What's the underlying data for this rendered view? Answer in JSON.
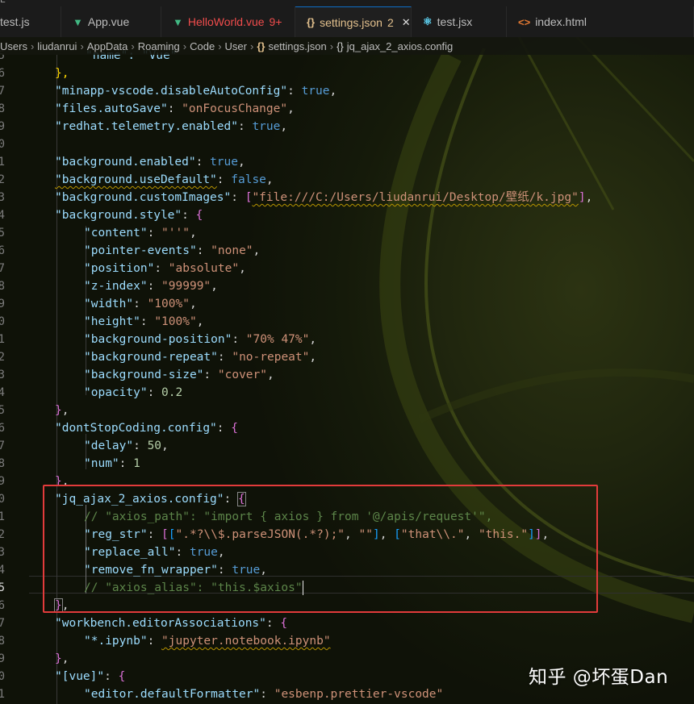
{
  "top_strip": {
    "left_text": "L",
    "right_text": "·"
  },
  "tabs": [
    {
      "label": "test.js",
      "icon": "js-file-icon",
      "color": "#cccccc"
    },
    {
      "label": "App.vue",
      "icon": "vue-icon",
      "color": "#cccccc"
    },
    {
      "label": "HelloWorld.vue",
      "badge": "9+",
      "icon": "vue-icon",
      "color": "#f14c4c"
    },
    {
      "label": "settings.json",
      "badge": "2",
      "icon": "json-braces-icon",
      "color": "#e2c08d",
      "active": true
    },
    {
      "label": "test.jsx",
      "icon": "react-icon",
      "color": "#cccccc"
    },
    {
      "label": "index.html",
      "icon": "html-icon",
      "color": "#cccccc"
    }
  ],
  "breadcrumb": [
    "Users",
    "liudanrui",
    "AppData",
    "Roaming",
    "Code",
    "User",
    "settings.json",
    "jq_ajax_2_axios.config"
  ],
  "line_numbers": [
    "5",
    "6",
    "7",
    "8",
    "9",
    "0",
    "1",
    "2",
    "3",
    "4",
    "5",
    "6",
    "7",
    "8",
    "9",
    "0",
    "1",
    "2",
    "3",
    "4",
    "5",
    "6",
    "7",
    "8",
    "9",
    "0",
    "1",
    "2",
    "3",
    "4",
    "5",
    "6",
    "7",
    "8",
    "9",
    "0",
    "1"
  ],
  "current_line_index": 30,
  "code": {
    "l0": "\"name\": \"Vue\"",
    "l1_close": "},",
    "l2_key": "\"minapp-vscode.disableAutoConfig\"",
    "l2_val": "true",
    "l3_key": "\"files.autoSave\"",
    "l3_val": "\"onFocusChange\"",
    "l4_key": "\"redhat.telemetry.enabled\"",
    "l4_val": "true",
    "l6_key": "\"background.enabled\"",
    "l6_val": "true",
    "l7_key": "\"background.useDefault\"",
    "l7_val": "false",
    "l8_key": "\"background.customImages\"",
    "l8_val": "\"file:///C:/Users/liudanrui/Desktop/壁纸/k.jpg\"",
    "l9_key": "\"background.style\"",
    "l10_key": "\"content\"",
    "l10_val": "\"''\"",
    "l11_key": "\"pointer-events\"",
    "l11_val": "\"none\"",
    "l12_key": "\"position\"",
    "l12_val": "\"absolute\"",
    "l13_key": "\"z-index\"",
    "l13_val": "\"99999\"",
    "l14_key": "\"width\"",
    "l14_val": "\"100%\"",
    "l15_key": "\"height\"",
    "l15_val": "\"100%\"",
    "l16_key": "\"background-position\"",
    "l16_val": "\"70% 47%\"",
    "l17_key": "\"background-repeat\"",
    "l17_val": "\"no-repeat\"",
    "l18_key": "\"background-size\"",
    "l18_val": "\"cover\"",
    "l19_key": "\"opacity\"",
    "l19_val": "0.2",
    "l21_key": "\"dontStopCoding.config\"",
    "l22_key": "\"delay\"",
    "l22_val": "50",
    "l23_key": "\"num\"",
    "l23_val": "1",
    "l25_key": "\"jq_ajax_2_axios.config\"",
    "l26_comment": "// \"axios_path\": \"import { axios } from '@/apis/request'\",",
    "l27_key": "\"reg_str\"",
    "l27_s1": "\".*?\\\\$.parseJSON(.*?);\"",
    "l27_s2": "\"\"",
    "l27_s3": "\"that\\\\.\"",
    "l27_s4": "\"this.\"",
    "l28_key": "\"replace_all\"",
    "l28_val": "true",
    "l29_key": "\"remove_fn_wrapper\"",
    "l29_val": "true",
    "l30_comment": "// \"axios_alias\": \"this.$axios\"",
    "l32_key": "\"workbench.editorAssociations\"",
    "l33_key": "\"*.ipynb\"",
    "l33_val": "\"jupyter.notebook.ipynb\"",
    "l35_key": "\"[vue]\"",
    "l36_key": "\"editor.defaultFormatter\"",
    "l36_val": "\"esbenp.prettier-vscode\""
  },
  "watermark": "知乎 @坏蛋Dan",
  "colors": {
    "highlight_box": "#e23b3b",
    "active_tab_border": "#0e6ec7"
  }
}
